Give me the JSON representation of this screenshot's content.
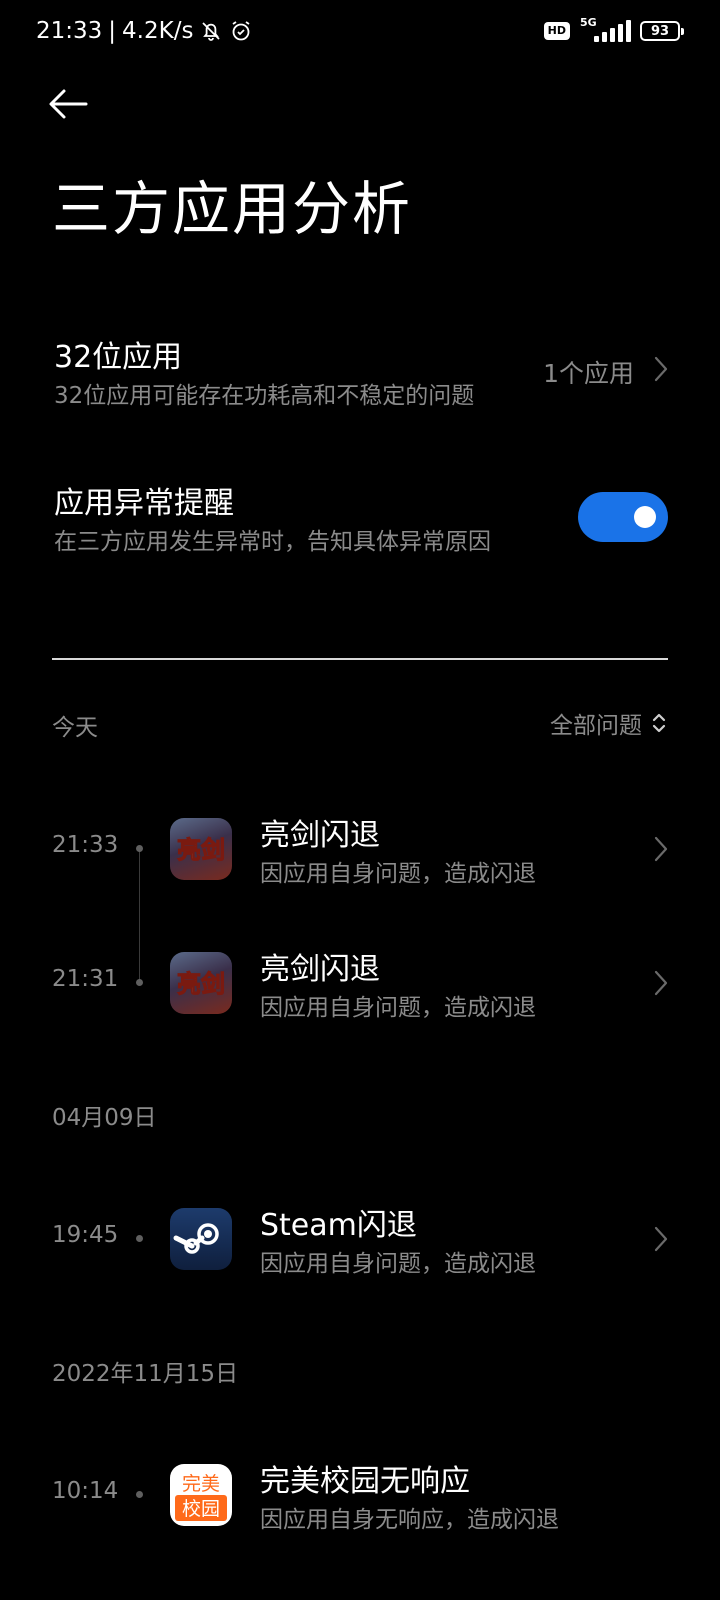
{
  "status_bar": {
    "time": "21:33",
    "separator": "|",
    "net_speed": "4.2K/s",
    "hd_badge": "HD",
    "network_type": "5G",
    "battery": "93"
  },
  "header": {
    "title": "三方应用分析"
  },
  "settings": {
    "bit32": {
      "title": "32位应用",
      "subtitle": "32位应用可能存在功耗高和不稳定的问题",
      "value": "1个应用"
    },
    "abnormal_alert": {
      "title": "应用异常提醒",
      "subtitle": "在三方应用发生异常时，告知具体异常原因",
      "enabled": true
    }
  },
  "list": {
    "filter_label": "全部问题",
    "groups": [
      {
        "date": "今天",
        "entries": [
          {
            "time": "21:33",
            "title": "亮剑闪退",
            "subtitle": "因应用自身问题，造成闪退",
            "icon": "liangjian-app-icon"
          },
          {
            "time": "21:31",
            "title": "亮剑闪退",
            "subtitle": "因应用自身问题，造成闪退",
            "icon": "liangjian-app-icon"
          }
        ]
      },
      {
        "date": "04月09日",
        "entries": [
          {
            "time": "19:45",
            "title": "Steam闪退",
            "subtitle": "因应用自身问题，造成闪退",
            "icon": "steam-app-icon"
          }
        ]
      },
      {
        "date": "2022年11月15日",
        "entries": [
          {
            "time": "10:14",
            "title": "完美校园无响应",
            "subtitle": "因应用自身无响应，造成闪退",
            "icon": "wanmei-app-icon"
          }
        ]
      }
    ]
  },
  "app_icon_text": {
    "liangjian": "亮剑",
    "wanmei_line1": "完美",
    "wanmei_line2": "校园"
  },
  "colors": {
    "background": "#000000",
    "accent": "#1a73e8",
    "secondary_text": "#8b8b8b",
    "wanmei_orange": "#ff6a1a"
  }
}
